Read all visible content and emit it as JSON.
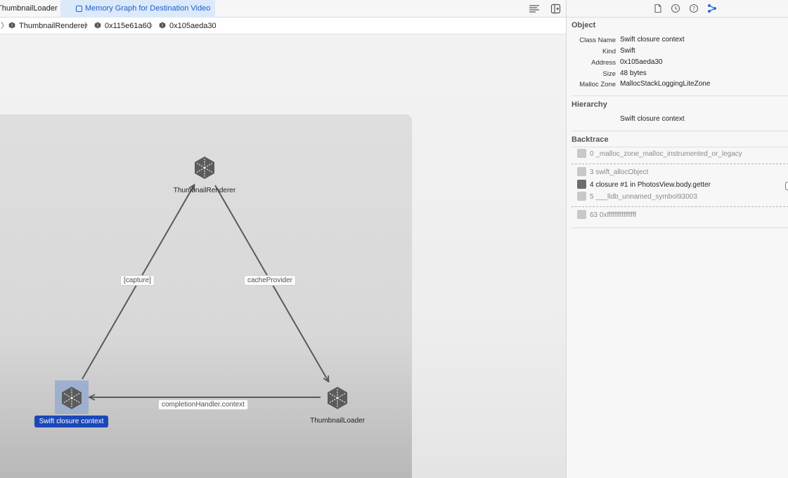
{
  "tabs": [
    {
      "label": "ThumbnailLoader",
      "active": false
    },
    {
      "label": "Memory Graph for Destination Video",
      "active": true
    }
  ],
  "toolbar_icons": [
    "editor-options-icon",
    "add-editor-icon"
  ],
  "breadcrumb": [
    {
      "label": "ThumbnailRenderer",
      "icon": "object-cube-icon"
    },
    {
      "label": "0x115e61a60",
      "icon": "object-cube-icon"
    },
    {
      "label": "0x105aeda30",
      "icon": "object-cube-icon"
    }
  ],
  "graph": {
    "nodes": [
      {
        "label": "ThumbnailRenderer",
        "icon": "object-cube-icon",
        "selected": false
      },
      {
        "label": "Swift closure context",
        "icon": "object-cube-icon",
        "selected": true
      },
      {
        "label": "ThumbnailLoader",
        "icon": "object-cube-icon",
        "selected": false
      }
    ],
    "edges": [
      {
        "from": "Swift closure context",
        "to": "ThumbnailRenderer",
        "label": "[capture]"
      },
      {
        "from": "ThumbnailRenderer",
        "to": "ThumbnailLoader",
        "label": "cacheProvider"
      },
      {
        "from": "ThumbnailLoader",
        "to": "Swift closure context",
        "label": "completionHandler.context"
      }
    ]
  },
  "inspector": {
    "tab_icons": [
      "file-icon",
      "history-icon",
      "help-icon",
      "memory-graph-icon"
    ],
    "object": {
      "title": "Object",
      "fields": [
        {
          "key": "Class Name",
          "value": "Swift closure context"
        },
        {
          "key": "Kind",
          "value": "Swift"
        },
        {
          "key": "Address",
          "value": "0x105aeda30"
        },
        {
          "key": "Size",
          "value": "48 bytes"
        },
        {
          "key": "Malloc Zone",
          "value": "MallocStackLoggingLiteZone"
        }
      ]
    },
    "hierarchy": {
      "title": "Hierarchy",
      "value": "Swift closure context"
    },
    "backtrace": {
      "title": "Backtrace",
      "frames": [
        {
          "label": "0 _malloc_zone_malloc_instrumented_or_legacy",
          "icon": "library-icon",
          "dim": true
        },
        {
          "label": "3 swift_allocObject",
          "icon": "code-icon",
          "dim": true
        },
        {
          "label": "4 closure #1 in PhotosView.body.getter",
          "icon": "user-code-icon",
          "dim": false
        },
        {
          "label": "5 ___lldb_unnamed_symbol93003",
          "icon": "pencil-icon",
          "dim": true
        },
        {
          "label": "63 0xffffffffffffffff",
          "icon": "gear-icon",
          "dim": true
        }
      ]
    }
  },
  "colors": {
    "accent": "#1b48b8",
    "tab_active_bg": "#dbe9fb",
    "tab_active_text": "#1f5fc9",
    "selected_node_bg": "#9fb0cf"
  }
}
